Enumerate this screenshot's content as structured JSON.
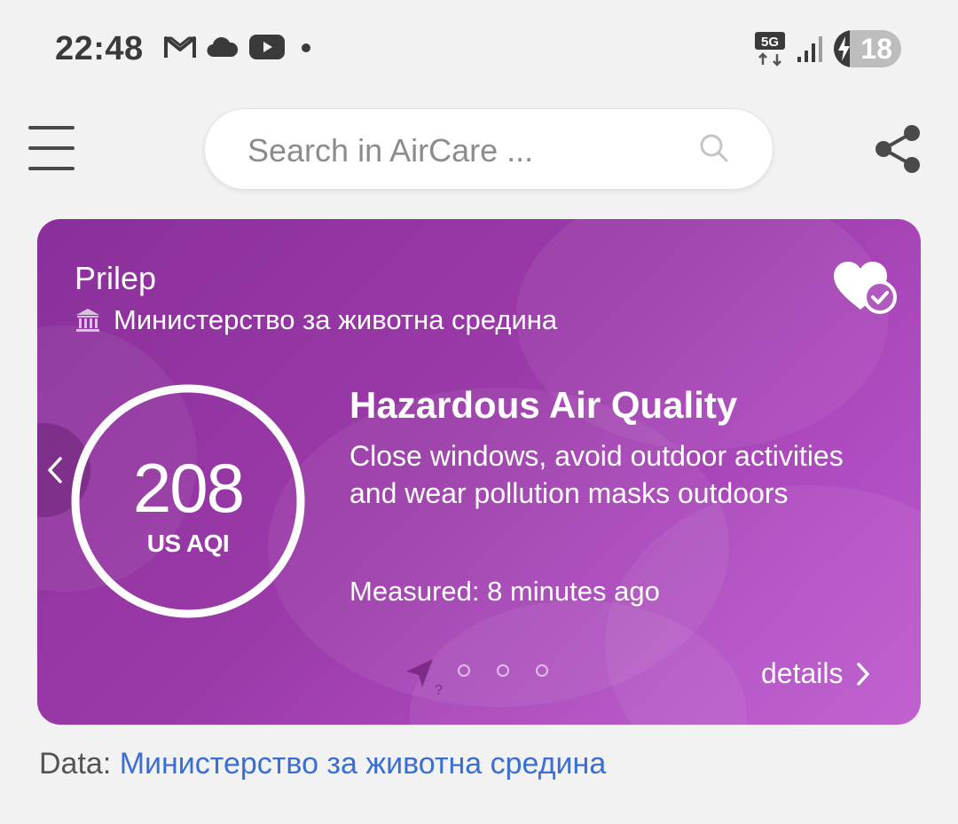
{
  "status_bar": {
    "time": "22:48",
    "network": "5G",
    "battery": "18",
    "icons_left": [
      "gmail-icon",
      "cloud-icon",
      "youtube-icon",
      "notification-dot-icon"
    ],
    "icons_right": [
      "5g-data-icon",
      "signal-icon",
      "battery-charging-icon"
    ]
  },
  "toolbar": {
    "menu_icon": "hamburger-menu-icon",
    "search_placeholder": "Search in AirCare ...",
    "search_icon": "search-icon",
    "share_icon": "share-icon"
  },
  "card": {
    "city": "Prilep",
    "source": "Министерство за животна средина",
    "source_icon": "government-building-icon",
    "favorite_icon": "heart-check-icon",
    "aqi": {
      "value": "208",
      "unit": "US AQI"
    },
    "status_title": "Hazardous Air Quality",
    "status_description": "Close windows, avoid outdoor activities and wear pollution masks outdoors",
    "measured": "Measured: 8 minutes ago",
    "pager": {
      "locate_icon": "location-unknown-icon",
      "dots": 3
    },
    "details_label": "details",
    "colors": {
      "gradient_start": "#8a2f9a",
      "gradient_end": "#bb58cc"
    }
  },
  "footer": {
    "data_label": "Data:",
    "data_source": "Министерство за животна средина",
    "link_color": "#3a6fd1"
  }
}
